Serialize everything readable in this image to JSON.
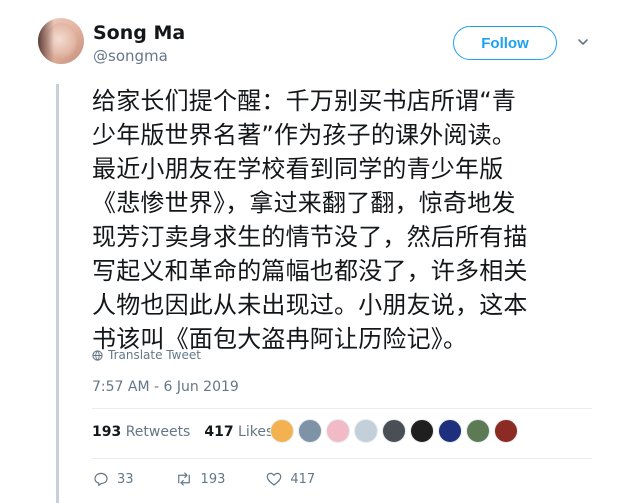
{
  "user": {
    "name": "Song Ma",
    "handle": "@songma"
  },
  "follow_label": "Follow",
  "tweet_lines": [
    "给家长们提个醒：千万别买书店所谓“青",
    "少年版世界名著”作为孩子的课外阅读。",
    "最近小朋友在学校看到同学的青少年版",
    "《悲惨世界》，拿过来翻了翻，惊奇地发",
    "现芳汀卖身求生的情节没了，然后所有描",
    "写起义和革命的篇幅也都没了，许多相关",
    "人物也因此从未出现过。小朋友说，这本",
    "书该叫《面包大盗冉阿让历险记》。"
  ],
  "translate_label": "Translate Tweet",
  "timestamp": "7:57 AM - 6 Jun 2019",
  "stats": {
    "retweets_count": "193",
    "retweets_label": "Retweets",
    "likes_count": "417",
    "likes_label": "Likes"
  },
  "actions": {
    "replies": "33",
    "retweets": "193",
    "likes": "417"
  },
  "liker_avatars": [
    {
      "color": "#f3b24f",
      "icon": "avatar-icon"
    },
    {
      "color": "#7f93a6",
      "icon": "avatar-icon"
    },
    {
      "color": "#f2b9c6",
      "icon": "avatar-icon"
    },
    {
      "color": "#c3d0da",
      "icon": "avatar-icon"
    },
    {
      "color": "#4a4f56",
      "icon": "avatar-icon"
    },
    {
      "color": "#1f1f1f",
      "icon": "avatar-icon"
    },
    {
      "color": "#1d2f7d",
      "icon": "avatar-icon"
    },
    {
      "color": "#5c7b54",
      "icon": "avatar-icon"
    },
    {
      "color": "#8b2b24",
      "icon": "avatar-icon"
    }
  ]
}
